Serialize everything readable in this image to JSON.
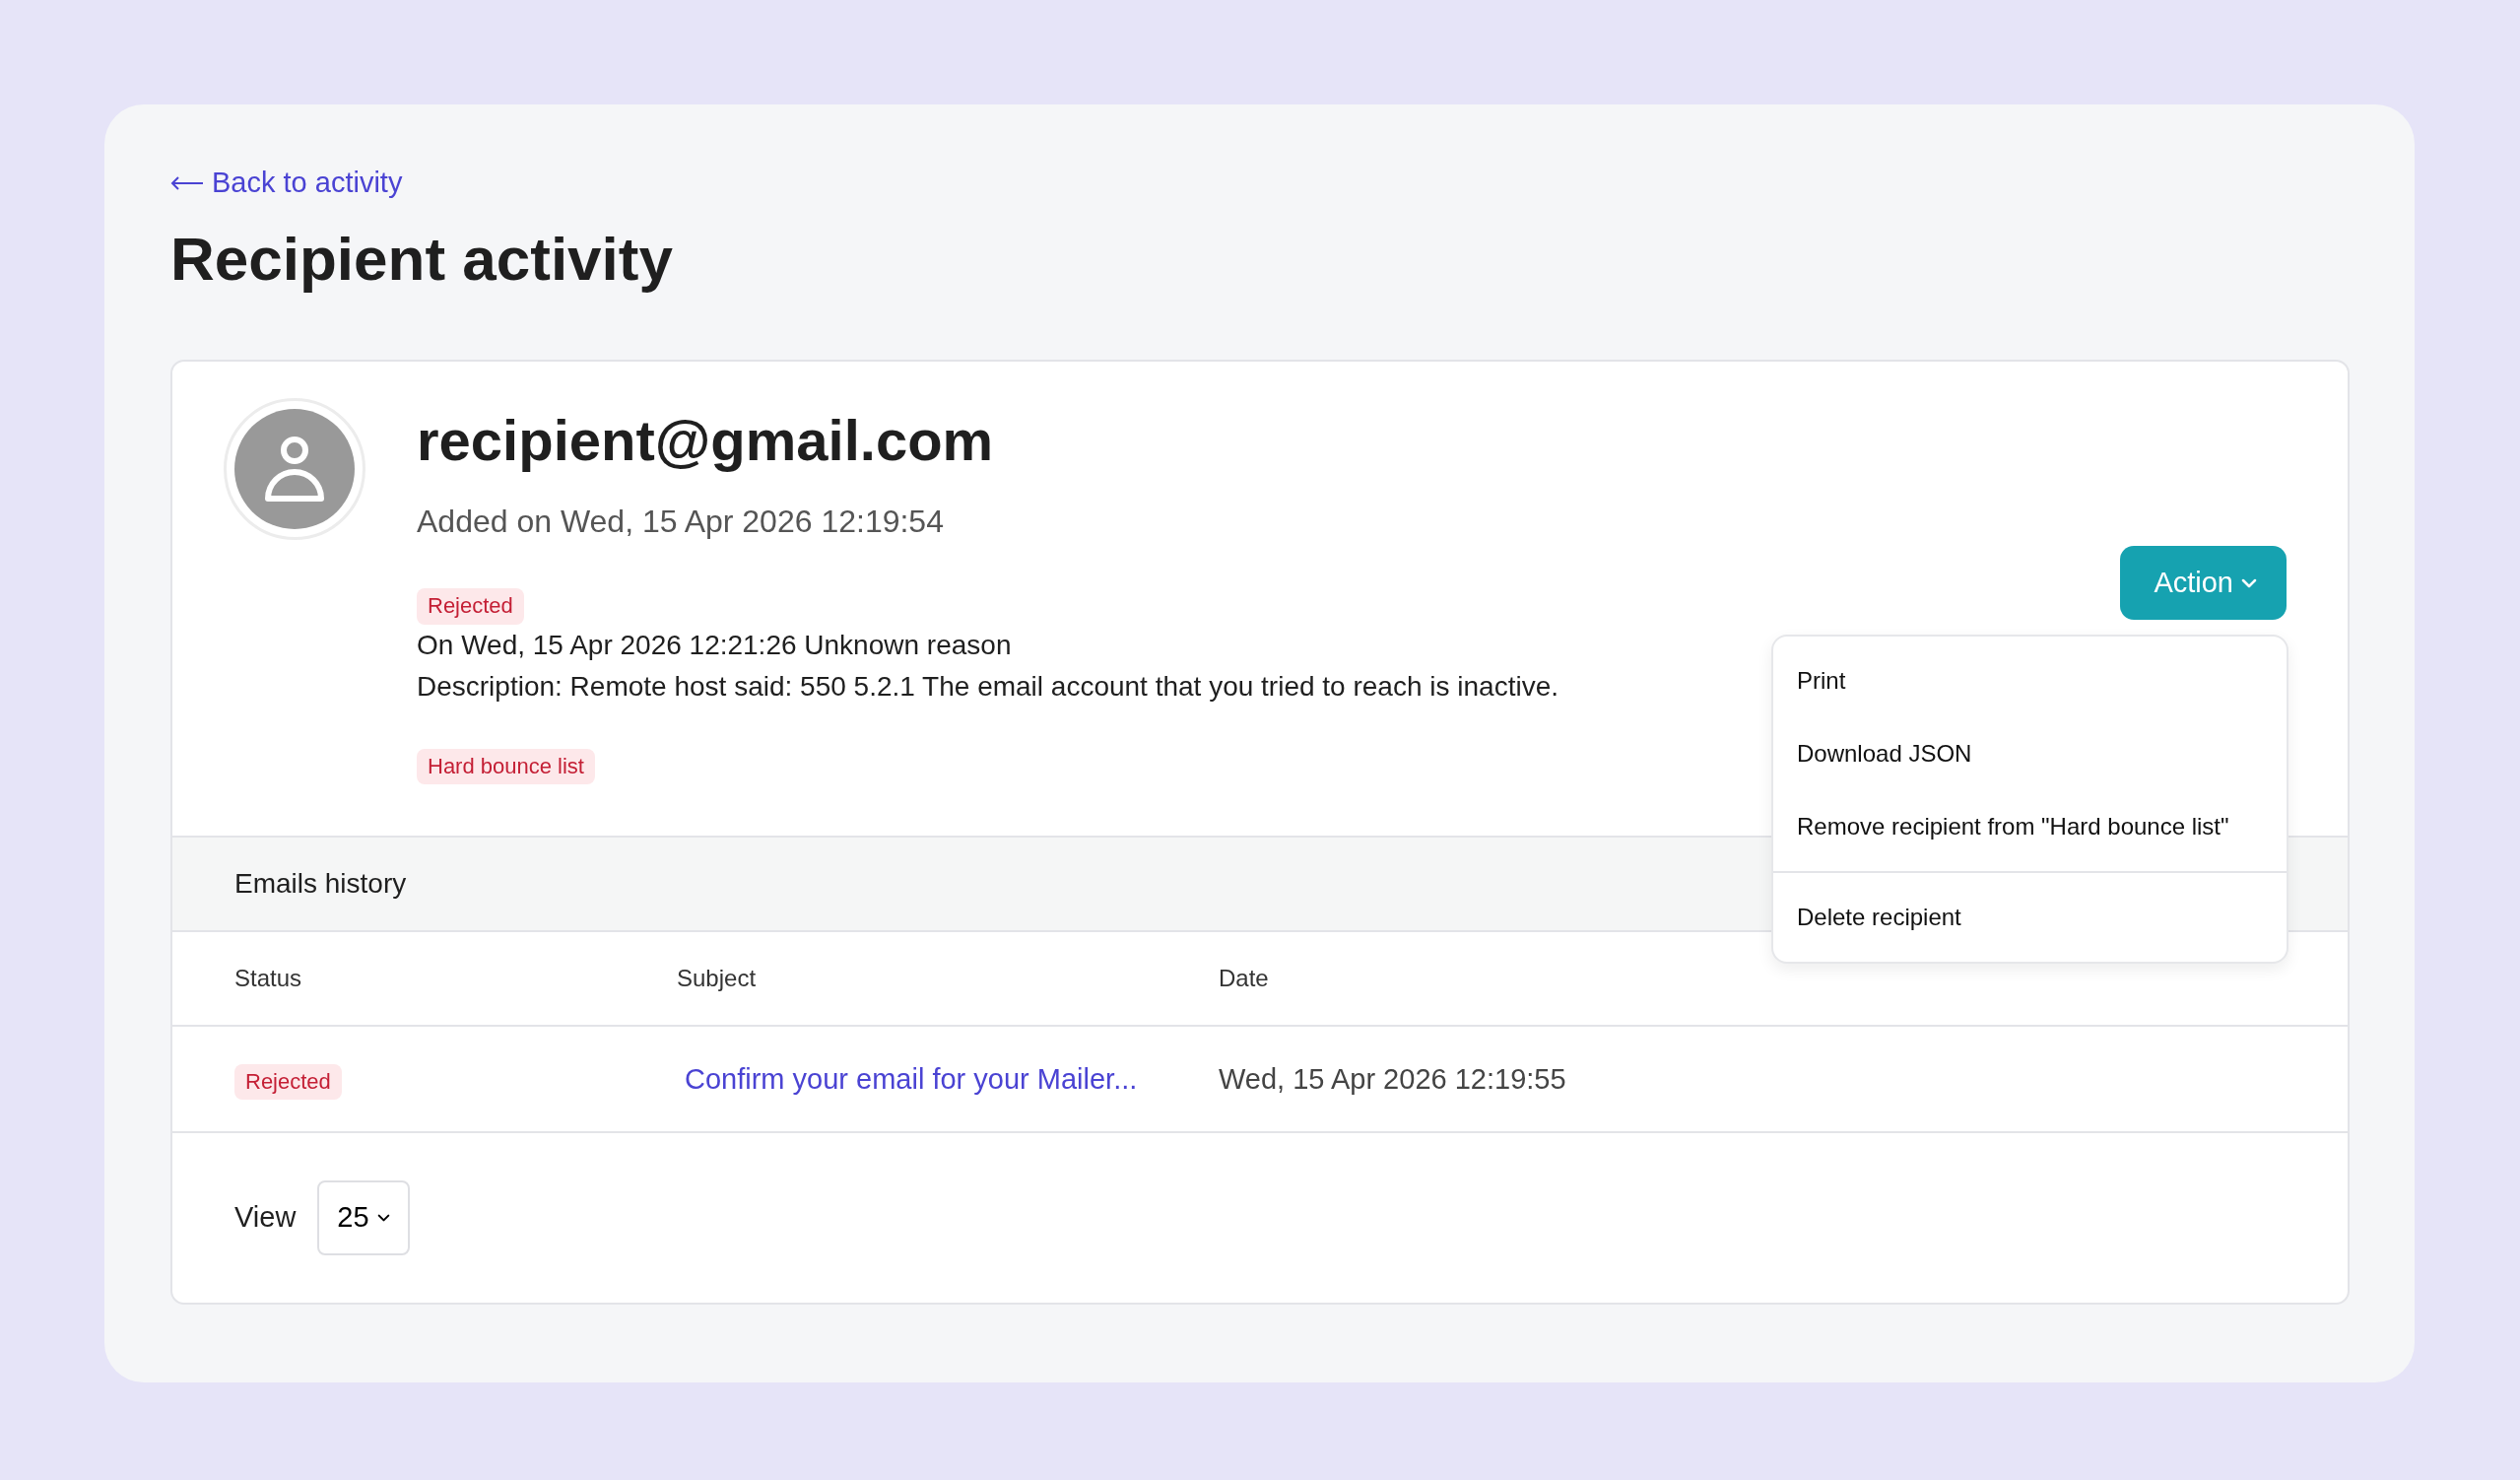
{
  "back_link": {
    "label": "Back to activity"
  },
  "title": "Recipient activity",
  "recipient": {
    "email": "recipient@gmail.com",
    "added": "Added on Wed, 15 Apr 2026 12:19:54",
    "status_badge": "Rejected",
    "event": "On Wed, 15 Apr 2026 12:21:26 Unknown reason",
    "description": "Description: Remote host said: 550 5.2.1 The email account that you tried to reach is inactive.",
    "list_badge": "Hard bounce list"
  },
  "action_menu": {
    "label": "Action",
    "expanded": true,
    "items": [
      {
        "kind": "item",
        "label": "Print"
      },
      {
        "kind": "item",
        "label": "Download JSON"
      },
      {
        "kind": "item",
        "label": "Remove recipient from \"Hard bounce list\""
      },
      {
        "kind": "divider"
      },
      {
        "kind": "item",
        "label": "Delete recipient"
      }
    ]
  },
  "emails_history": {
    "title": "Emails history",
    "columns": [
      "Status",
      "Subject",
      "Date"
    ],
    "rows": [
      {
        "status": "Rejected",
        "subject": "Confirm your email for your Mailer...",
        "date": "Wed, 15 Apr 2026 12:19:55"
      }
    ]
  },
  "pagination": {
    "label": "View",
    "page_size": "25"
  }
}
